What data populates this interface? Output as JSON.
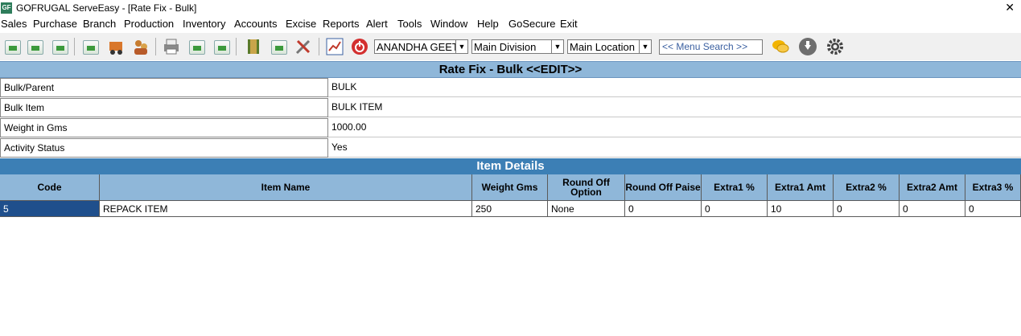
{
  "window": {
    "title": "GOFRUGAL ServeEasy - [Rate Fix - Bulk]",
    "icon": "gofrugal-app-icon",
    "close": "✕"
  },
  "menu": [
    "Sales",
    "Purchase",
    "Branch",
    "Production",
    "Inventory",
    "Accounts",
    "Excise",
    "Reports",
    "Alert",
    "Tools",
    "Window",
    "Help",
    "GoSecure",
    "Exit"
  ],
  "toolbar": {
    "user": "ANANDHA GEET",
    "division": "Main Division",
    "location": "Main Location",
    "menu_search_placeholder": "<< Menu Search >>"
  },
  "form": {
    "title": "Rate Fix - Bulk <<EDIT>>",
    "fields": [
      {
        "label": "Bulk/Parent",
        "value": "BULK"
      },
      {
        "label": "Bulk Item",
        "value": "BULK ITEM"
      },
      {
        "label": "Weight in Gms",
        "value": "1000.00"
      },
      {
        "label": "Activity Status",
        "value": "Yes"
      }
    ]
  },
  "details": {
    "title": "Item Details",
    "columns": [
      "Code",
      "Item Name",
      "Weight  Gms",
      "Round Off Option",
      "Round Off Paise",
      "Extra1 %",
      "Extra1 Amt",
      "Extra2 %",
      "Extra2 Amt",
      "Extra3 %"
    ],
    "rows": [
      [
        "5",
        "REPACK ITEM",
        "250",
        "None",
        "0",
        "0",
        "10",
        "0",
        "0",
        "0"
      ]
    ]
  },
  "colors": {
    "header_light": "#8fb7d9",
    "header_dark": "#3c7fb5",
    "selected_cell": "#1f4f8c"
  }
}
